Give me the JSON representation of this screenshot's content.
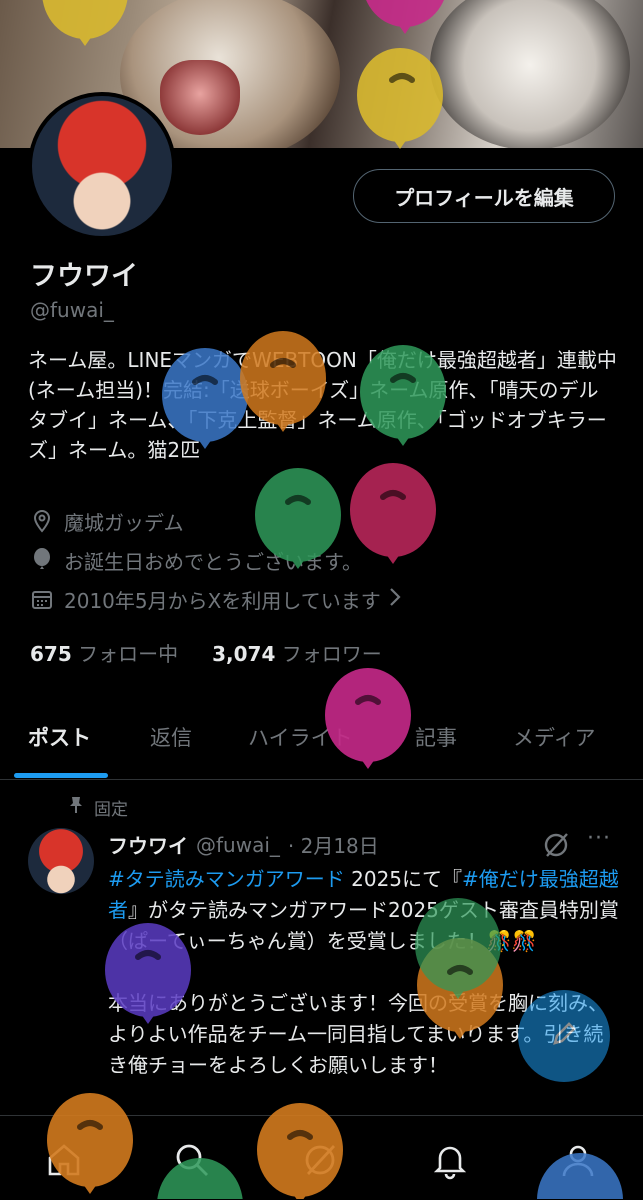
{
  "profile": {
    "edit_button": "プロフィールを編集",
    "name": "フウワイ",
    "handle": "@fuwai_",
    "bio": "ネーム屋。LINEマンガでWEBTOON「俺だけ最強超越者」連載中(ネーム担当)！完結:「送球ボーイズ」ネーム原作、「晴天のデルタブイ」ネーム、「下克上監督」ネーム原作、「ゴッドオブキラーズ」ネーム。猫2匹",
    "location": "魔城ガッデム",
    "birthday": "お誕生日おめでとうございます。",
    "joined": "2010年5月からXを利用しています",
    "following_count": "675",
    "following_label": "フォロー中",
    "followers_count": "3,074",
    "followers_label": "フォロワー"
  },
  "tabs": [
    {
      "label": "ポスト",
      "active": true
    },
    {
      "label": "返信",
      "active": false
    },
    {
      "label": "ハイライト",
      "active": false
    },
    {
      "label": "記事",
      "active": false
    },
    {
      "label": "メディア",
      "active": false
    }
  ],
  "post": {
    "pinned_label": "固定",
    "name": "フウワイ",
    "handle": "@fuwai_",
    "date": "· 2月18日",
    "more": "···",
    "tag1": "#タテ読みマンガアワード",
    "text1": " 2025にて『",
    "tag2": "#俺だけ最強超越者",
    "text2": "』がタテ読みマンガアワード2025ゲスト審査員特別賞（ぱーてぃーちゃん賞）を受賞しました！🎊🎊",
    "text3": "本当にありがとうございます！今回の受賞を胸に刻み、よりよい作品をチーム一同目指してまいります。引き続き俺チョーをよろしくお願いします！"
  },
  "nav": [
    "home-icon",
    "search-icon",
    "grok-icon",
    "notifications-icon",
    "profile-icon"
  ],
  "colors": {
    "accent": "#1d9bf0",
    "background": "#000000",
    "muted": "#71767b"
  },
  "balloons": [
    "yellow",
    "magenta",
    "yellow",
    "blue",
    "orange",
    "green",
    "green",
    "crimson",
    "magenta",
    "purple",
    "green",
    "orange",
    "orange",
    "blue",
    "orange",
    "green"
  ]
}
